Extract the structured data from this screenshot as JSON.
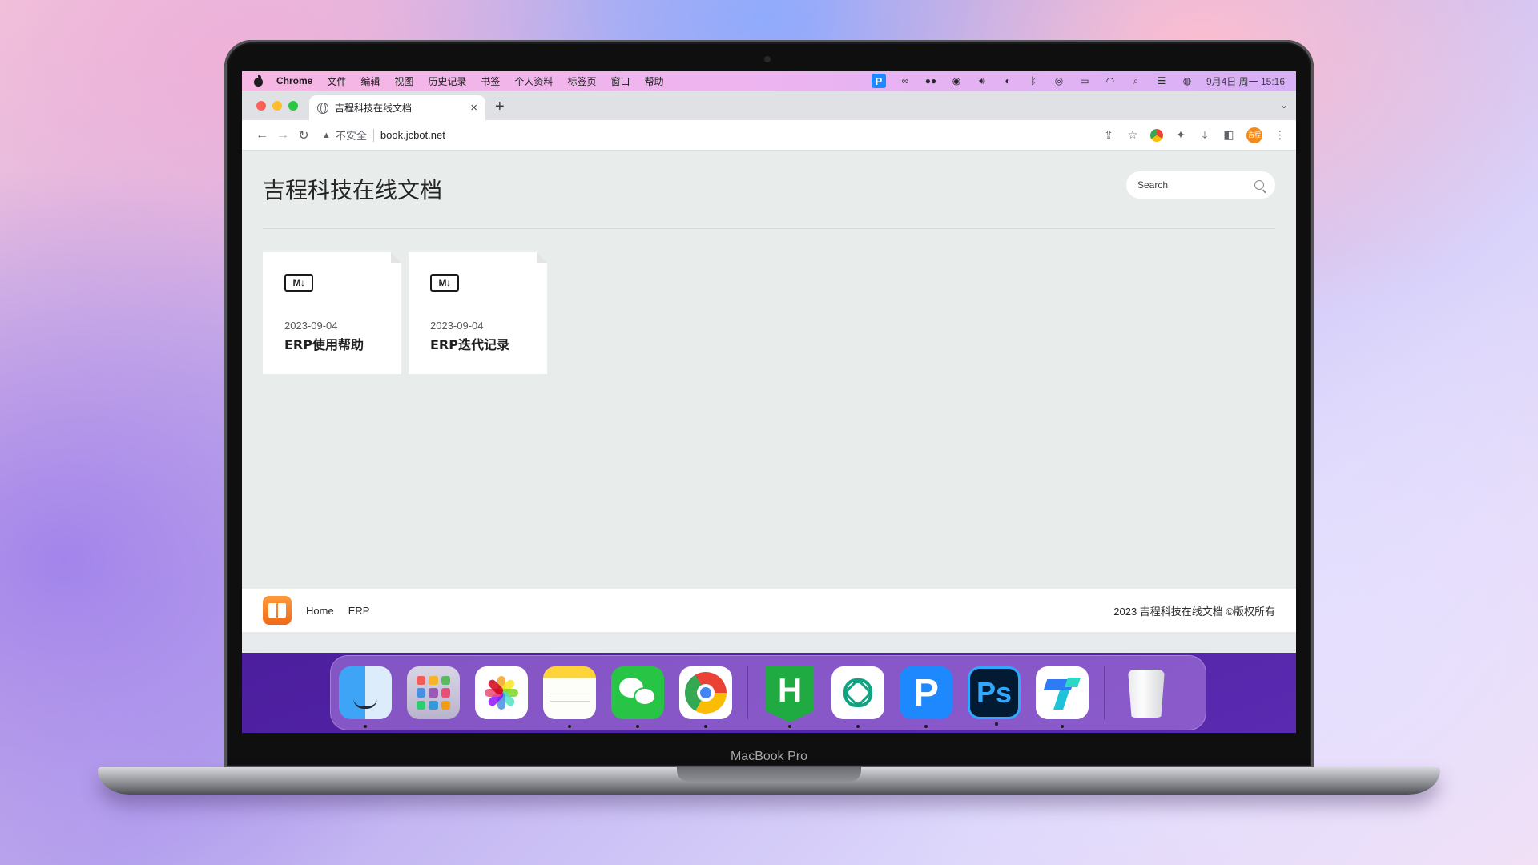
{
  "menubar": {
    "app_name": "Chrome",
    "menus": [
      "文件",
      "编辑",
      "视图",
      "历史记录",
      "书签",
      "个人资料",
      "标签页",
      "窗口",
      "帮助"
    ],
    "status_icons": [
      "p-status-icon",
      "creative-cloud-icon",
      "wechat-status-icon",
      "shield-status-icon",
      "volume-icon",
      "steam-icon",
      "bluetooth-icon",
      "user-icon",
      "battery-icon",
      "wifi-icon",
      "spotlight-icon",
      "control-center-icon",
      "siri-icon"
    ],
    "p_status_label": "P",
    "clock": "9月4日 周一 15:16"
  },
  "browser": {
    "tab_title": "吉程科技在线文档",
    "new_tab": "+",
    "tab_close": "×",
    "security_label": "不安全",
    "url": "book.jcbot.net",
    "profile_initials": "吉程"
  },
  "page": {
    "site_title": "吉程科技在线文档",
    "search_placeholder": "Search",
    "docs": [
      {
        "icon": "markdown-icon",
        "icon_label": "M↓",
        "date": "2023-09-04",
        "title": "ERP使用帮助"
      },
      {
        "icon": "markdown-icon",
        "icon_label": "M↓",
        "date": "2023-09-04",
        "title": "ERP迭代记录"
      }
    ]
  },
  "footer": {
    "links": [
      "Home",
      "ERP"
    ],
    "copyright": "2023 吉程科技在线文档 ©版权所有"
  },
  "dock": {
    "items": [
      "finder",
      "launchpad",
      "photos",
      "notes",
      "wechat",
      "chrome",
      "hbuilderx",
      "chatgpt",
      "pixso",
      "photoshop",
      "lark",
      "trash"
    ],
    "hbuilder_label": "H",
    "pixso_label": "P",
    "photoshop_label": "Ps"
  },
  "device": {
    "label": "MacBook Pro"
  },
  "colors": {
    "traffic_close": "#ff5f57",
    "traffic_min": "#febc2e",
    "traffic_max": "#28c840",
    "page_bg": "#e8edec",
    "profile": "#f28b1b"
  }
}
